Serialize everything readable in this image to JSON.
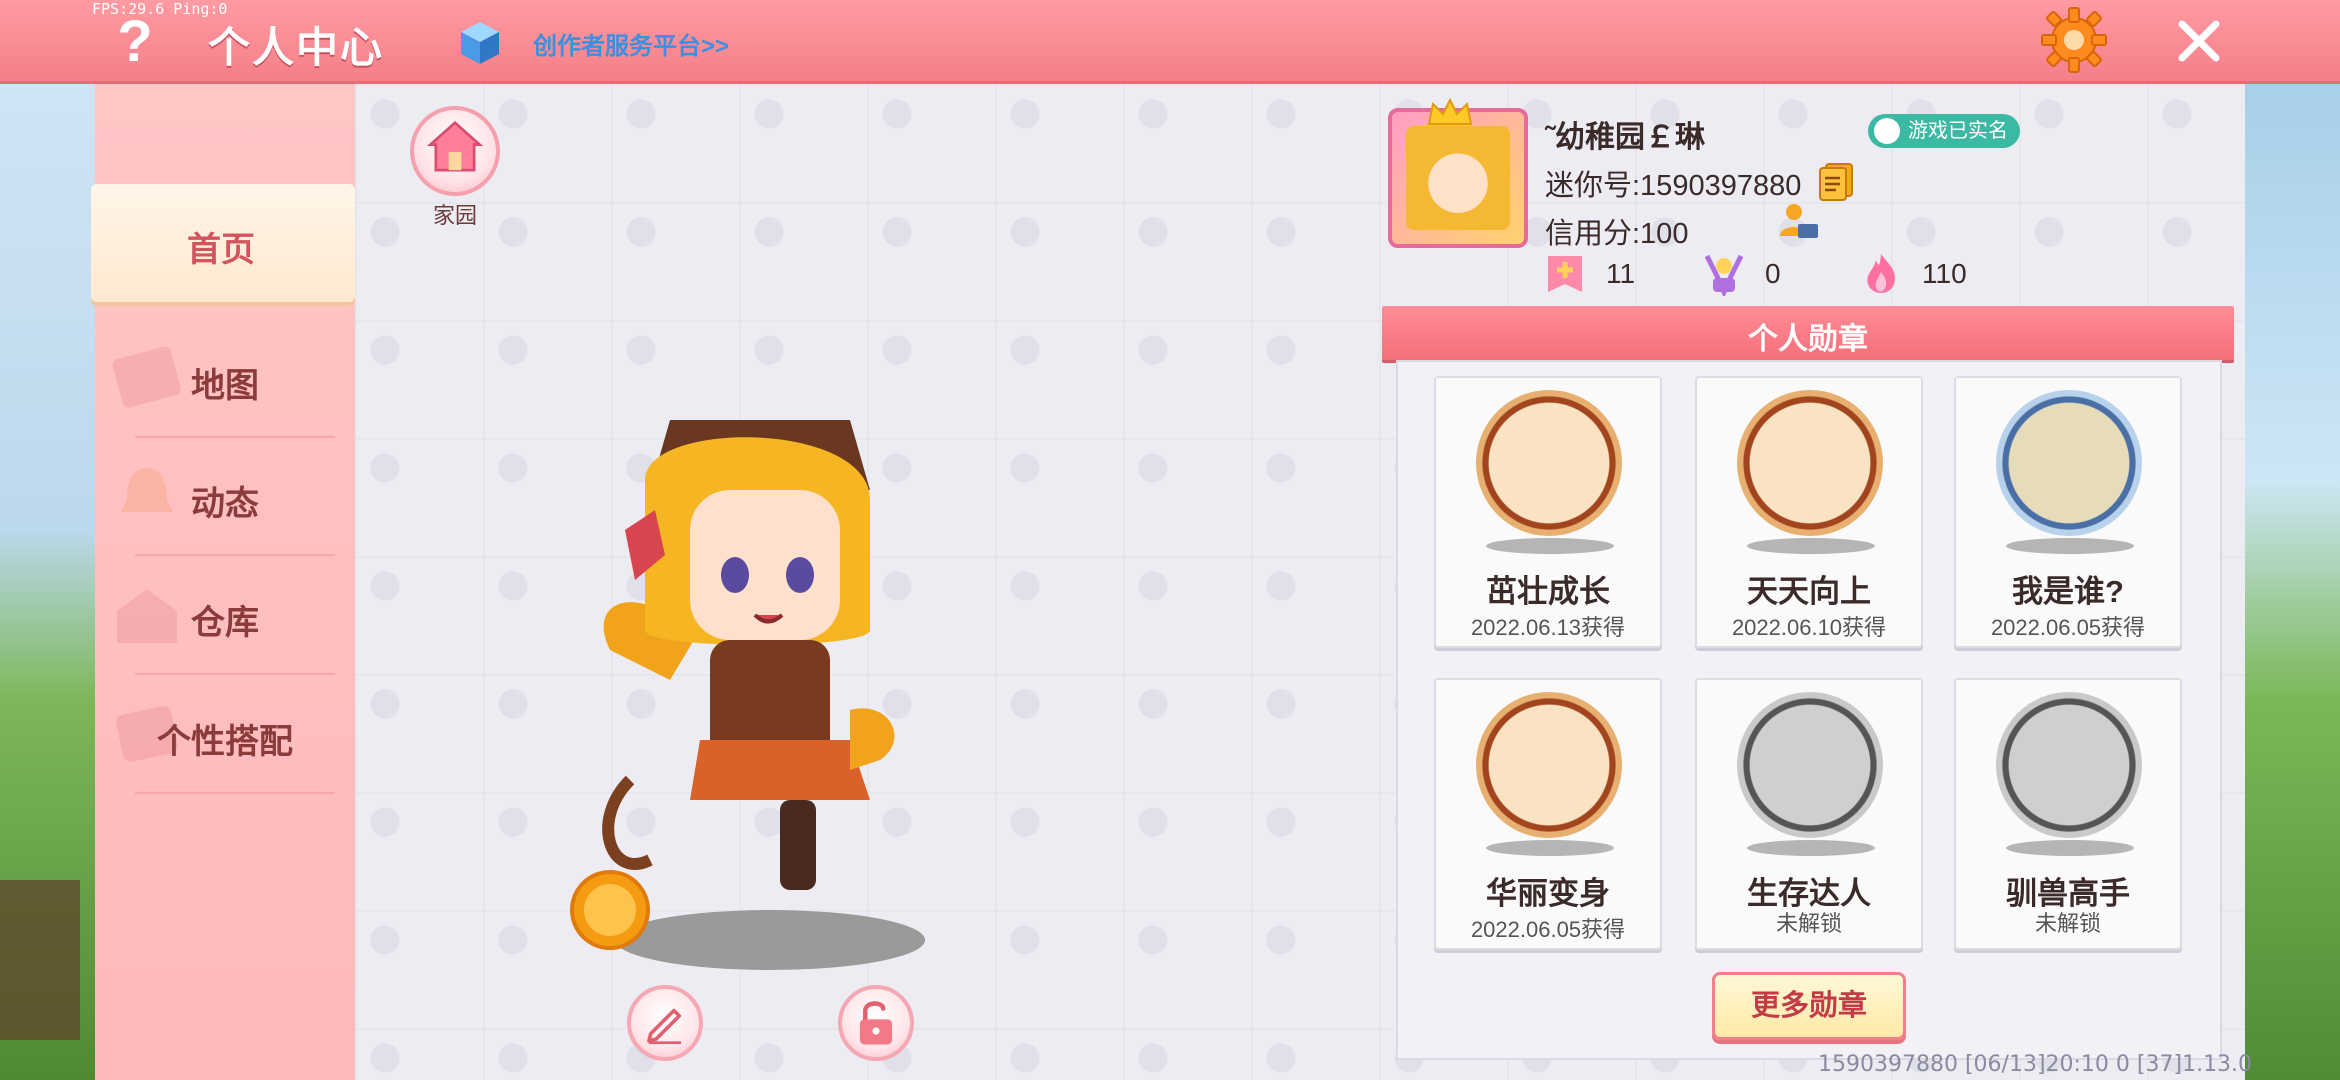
{
  "topbar": {
    "fps": "FPS:29.6 Ping:0",
    "title": "个人中心",
    "creator_link": "创作者服务平台>>"
  },
  "sidebar": {
    "items": [
      {
        "label": "首页",
        "active": true
      },
      {
        "label": "地图",
        "active": false
      },
      {
        "label": "动态",
        "active": false
      },
      {
        "label": "仓库",
        "active": false
      },
      {
        "label": "个性搭配",
        "active": false
      }
    ]
  },
  "home": {
    "label": "家园"
  },
  "profile": {
    "username": "˜幼稚园￡琳",
    "realname_badge": "游戏已实名",
    "mini_id": "迷你号:1590397880",
    "credit": "信用分:100",
    "stats": {
      "likes": "11",
      "fans": "0",
      "popularity": "110"
    }
  },
  "medals": {
    "header": "个人勋章",
    "items": [
      {
        "name": "茁壮成长",
        "date": "2022.06.13获得",
        "style": "gold"
      },
      {
        "name": "天天向上",
        "date": "2022.06.10获得",
        "style": "gold"
      },
      {
        "name": "我是谁?",
        "date": "2022.06.05获得",
        "style": "silver"
      },
      {
        "name": "华丽变身",
        "date": "2022.06.05获得",
        "style": "gold"
      },
      {
        "name": "生存达人",
        "date": "未解锁",
        "style": "grey"
      },
      {
        "name": "驯兽高手",
        "date": "未解锁",
        "style": "grey"
      }
    ],
    "more_button": "更多勋章"
  },
  "footer": {
    "info": "1590397880    [06/13]20:10 0   [37]1.13.0"
  },
  "colors": {
    "topbar": "#f47f89",
    "sidebar": "#ffb8bb",
    "accent": "#d2545f",
    "badge": "#3cb9a3"
  }
}
